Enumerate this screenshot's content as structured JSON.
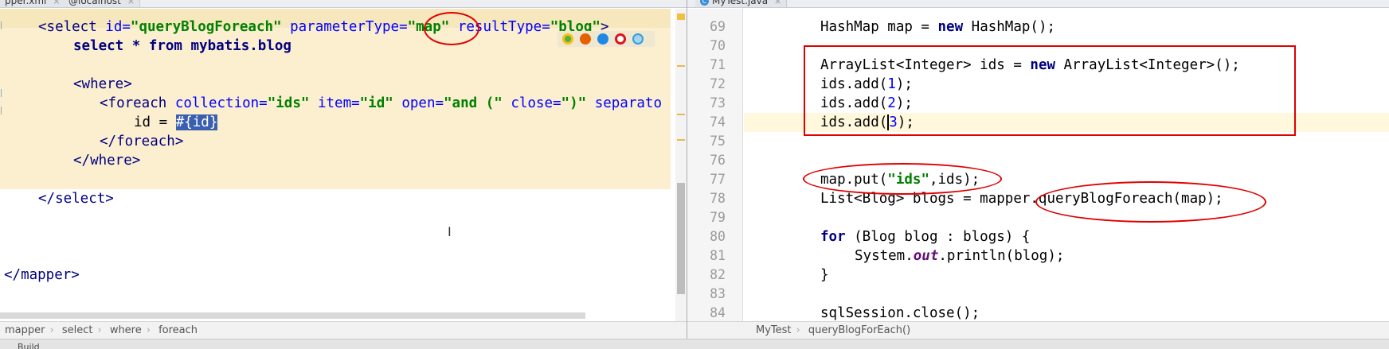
{
  "left_tabs": [
    {
      "label": "pper.xml",
      "close": "×"
    },
    {
      "label": "@localhost",
      "close": "×"
    }
  ],
  "right_tabs": [
    {
      "label": "MyTest.java",
      "close": "×",
      "icon": "C"
    }
  ],
  "xml_editor": {
    "line1": {
      "open": "<select ",
      "a_id": "id=",
      "v_id": "\"queryBlogForeach\"",
      "a_pt": " parameterType=",
      "v_pt": "\"map\"",
      "a_rt": " resultType=",
      "v_rt": "\"blog\"",
      "close": ">"
    },
    "line2": "select * from mybatis.blog",
    "line4": "<where>",
    "line5": {
      "open": "<foreach ",
      "a_col": "collection=",
      "v_col": "\"ids\"",
      "a_item": " item=",
      "v_item": "\"id\"",
      "a_open": " open=",
      "v_open": "\"and (\"",
      "a_close": " close=",
      "v_close": "\")\"",
      "a_sep": " separato"
    },
    "line6_prefix": "id = ",
    "line6_selected": "#{id}",
    "line7": "</foreach>",
    "line8": "</where>",
    "line10": "</select>",
    "line14": "</mapper>"
  },
  "java_editor": {
    "line_numbers": [
      "69",
      "70",
      "71",
      "72",
      "73",
      "74",
      "75",
      "76",
      "77",
      "78",
      "79",
      "80",
      "81",
      "82",
      "83",
      "84"
    ],
    "l69": {
      "a": "HashMap map = ",
      "kw": "new",
      "b": " HashMap();"
    },
    "l71": {
      "a": "ArrayList<Integer> ids = ",
      "kw": "new",
      "b": " ArrayList<Integer>();"
    },
    "l72": {
      "a": "ids.add(",
      "n": "1",
      "b": ");"
    },
    "l73": {
      "a": "ids.add(",
      "n": "2",
      "b": ");"
    },
    "l74": {
      "a": "ids.add(",
      "n": "3",
      "b": ");"
    },
    "l77": {
      "a": "map.put(",
      "s": "\"ids\"",
      "b": ",ids);"
    },
    "l78": "List<Blog> blogs = mapper.queryBlogForeach(map);",
    "l80": {
      "kw": "for",
      "b": " (Blog blog : blogs) {"
    },
    "l81": {
      "a": "System.",
      "i": "out",
      "b": ".println(blog);"
    },
    "l82": "}",
    "l84": "sqlSession.close();"
  },
  "breadcrumb_left": [
    "mapper",
    "select",
    "where",
    "foreach"
  ],
  "breadcrumb_right": [
    "MyTest",
    "queryBlogForEach()"
  ],
  "status": {
    "label": "Build"
  },
  "colors": {
    "annotation": "#e00000",
    "highlight": "#fbefd0",
    "selection": "#3a5fb0"
  }
}
